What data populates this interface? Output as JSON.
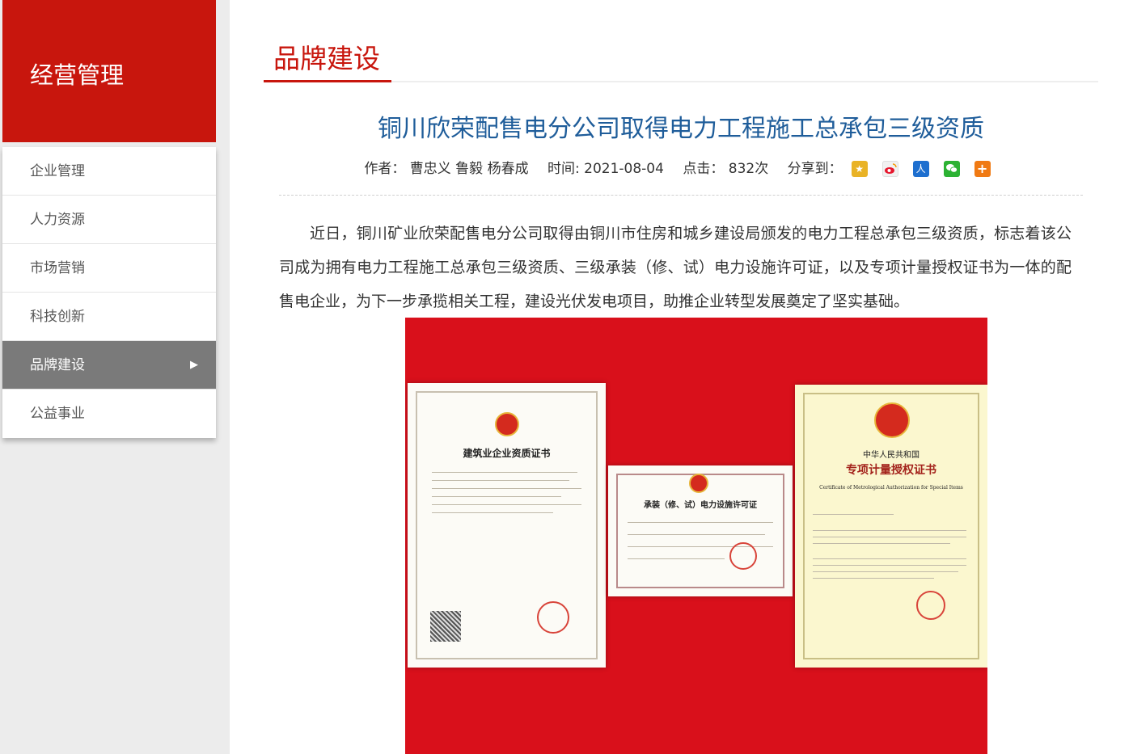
{
  "sidebar": {
    "title": "经营管理",
    "items": [
      {
        "label": "企业管理"
      },
      {
        "label": "人力资源"
      },
      {
        "label": "市场营销"
      },
      {
        "label": "科技创新"
      },
      {
        "label": "品牌建设",
        "active": true
      },
      {
        "label": "公益事业"
      }
    ],
    "active_arrow": "▶"
  },
  "section": {
    "title": "品牌建设"
  },
  "article": {
    "title": "铜川欣荣配售电分公司取得电力工程施工总承包三级资质",
    "author": "作者： 曹忠义 鲁毅 杨春成",
    "time": "时间: 2021-08-04",
    "clicks": "点击： 832次",
    "share_label": "分享到：",
    "share_icons": [
      "qzone-icon",
      "weibo-icon",
      "renren-icon",
      "wechat-icon",
      "more-share-icon"
    ],
    "body": "近日，铜川矿业欣荣配售电分公司取得由铜川市住房和城乡建设局颁发的电力工程总承包三级资质，标志着该公司成为拥有电力工程施工总承包三级资质、三级承装（修、试）电力设施许可证，以及专项计量授权证书为一体的配售电企业，为下一步承揽相关工程，建设光伏发电项目，助推企业转型发展奠定了坚实基础。"
  },
  "photo": {
    "certs": [
      {
        "title": "建筑业企业资质证书"
      },
      {
        "title": "承装（修、试）电力设施许可证"
      },
      {
        "title_top": "中华人民共和国",
        "title": "专项计量授权证书",
        "subtitle": "Certificate of Metrological Authorization for Special Items"
      }
    ]
  },
  "colors": {
    "brand_red": "#c8160d",
    "title_blue": "#1f5d9a",
    "active_gray": "#7a7a7a"
  }
}
